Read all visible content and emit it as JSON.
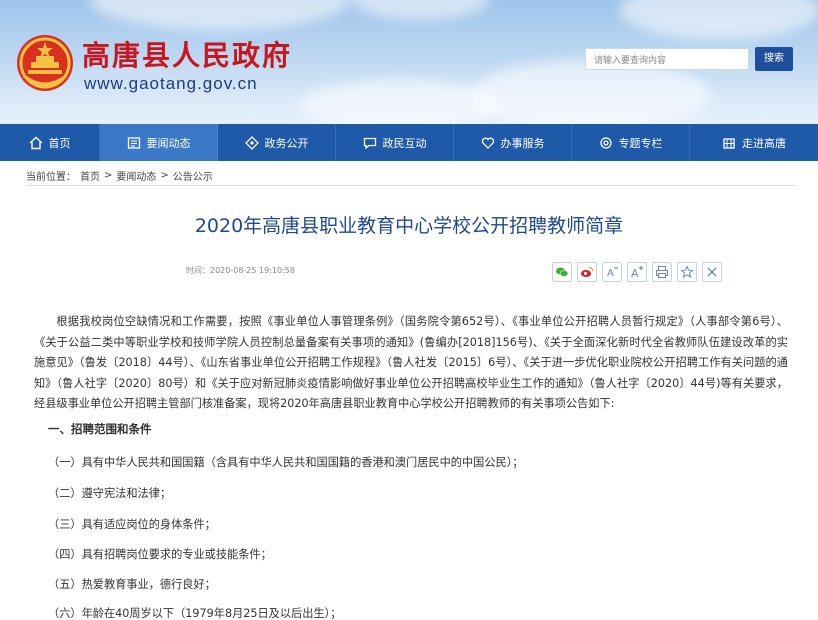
{
  "header": {
    "site_name": "高唐县人民政府",
    "site_url": "www.gaotang.gov.cn",
    "search_placeholder": "请输入要查询内容",
    "search_button": "搜索"
  },
  "nav": [
    {
      "label": "首页",
      "icon": "home-icon"
    },
    {
      "label": "要闻动态",
      "icon": "news-icon"
    },
    {
      "label": "政务公开",
      "icon": "gov-open-icon"
    },
    {
      "label": "政民互动",
      "icon": "chat-icon"
    },
    {
      "label": "办事服务",
      "icon": "heart-service-icon"
    },
    {
      "label": "专题专栏",
      "icon": "gear-topic-icon"
    },
    {
      "label": "走进高唐",
      "icon": "building-icon"
    }
  ],
  "breadcrumb": {
    "prefix": "当前位置：",
    "items": [
      "首页",
      "要闻动态",
      "公告公示"
    ],
    "separator": ">"
  },
  "article": {
    "title": "2020年高唐县职业教育中心学校公开招聘教师简章",
    "time": "时间：2020-08-25 19:10:58",
    "intro": "根据我校岗位空缺情况和工作需要，按照《事业单位人事管理条例》（国务院令第652号）、《事业单位公开招聘人员暂行规定》（人事部令第6号）、《关于公益二类中等职业学校和技师学院人员控制总量备案有关事项的通知》(鲁编办[2018]156号)、《关于全面深化新时代全省教师队伍建设改革的实施意见》（鲁发〔2018〕44号）、《山东省事业单位公开招聘工作规程》（鲁人社发〔2015〕6号）、《关于进一步优化职业院校公开招聘工作有关问题的通知》（鲁人社字〔2020〕80号）和《关于应对新冠肺炎疫情影响做好事业单位公开招聘高校毕业生工作的通知》（鲁人社字〔2020〕44号)等有关要求，经县级事业单位公开招聘主管部门核准备案，现将2020年高唐县职业教育中心学校公开招聘教师的有关事项公告如下:",
    "section_1": "一、招聘范围和条件",
    "conditions": [
      "（一）具有中华人民共和国国籍（含具有中华人民共和国国籍的香港和澳门居民中的中国公民）；",
      "（二）遵守宪法和法律；",
      "（三）具有适应岗位的身体条件；",
      "（四）具有招聘岗位要求的专业或技能条件；",
      "（五）热爱教育事业，德行良好；",
      "（六）年龄在40周岁以下（1979年8月25日及以后出生）；"
    ]
  },
  "colors": {
    "nav_bg": "#1f5aa8",
    "nav_active": "#3b78c6",
    "site_name": "#c8161d",
    "title": "#1f4a8c"
  }
}
